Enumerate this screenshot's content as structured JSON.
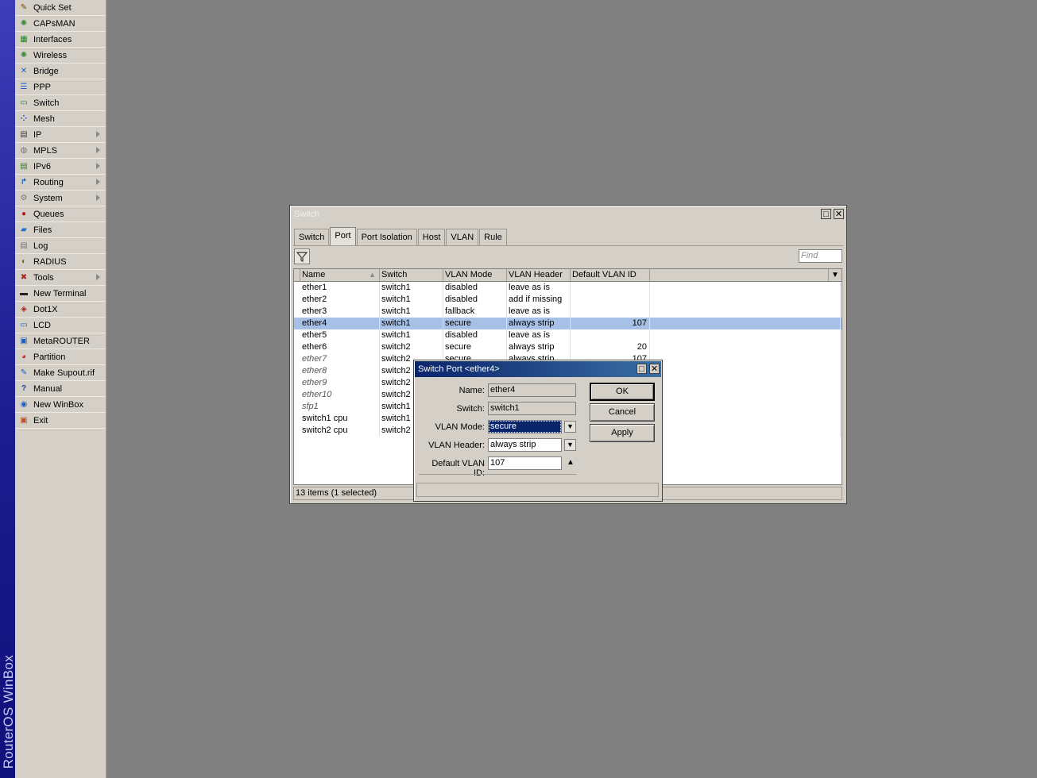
{
  "brand": "RouterOS WinBox",
  "sidebar": {
    "items": [
      {
        "label": "Quick Set",
        "icon": "wand-icon",
        "glyph": "✎",
        "color": "#7a4b00",
        "submenu": false
      },
      {
        "label": "CAPsMAN",
        "icon": "wifi-icon",
        "glyph": "✺",
        "color": "#3a8a3a",
        "submenu": false
      },
      {
        "label": "Interfaces",
        "icon": "interfaces-icon",
        "glyph": "▦",
        "color": "#228b22",
        "submenu": false
      },
      {
        "label": "Wireless",
        "icon": "wireless-icon",
        "glyph": "✺",
        "color": "#3a8a3a",
        "submenu": false
      },
      {
        "label": "Bridge",
        "icon": "bridge-icon",
        "glyph": "✕",
        "color": "#1f5fbf",
        "submenu": false
      },
      {
        "label": "PPP",
        "icon": "ppp-icon",
        "glyph": "☰",
        "color": "#1f5fbf",
        "submenu": false
      },
      {
        "label": "Switch",
        "icon": "switch-icon",
        "glyph": "▭",
        "color": "#2f7f2f",
        "submenu": false
      },
      {
        "label": "Mesh",
        "icon": "mesh-icon",
        "glyph": "⁘",
        "color": "#1f3f9f",
        "submenu": false
      },
      {
        "label": "IP",
        "icon": "ip-icon",
        "glyph": "▤",
        "color": "#444444",
        "submenu": true
      },
      {
        "label": "MPLS",
        "icon": "mpls-icon",
        "glyph": "◍",
        "color": "#777777",
        "submenu": true
      },
      {
        "label": "IPv6",
        "icon": "ipv6-icon",
        "glyph": "▤",
        "color": "#2f7f2f",
        "submenu": true
      },
      {
        "label": "Routing",
        "icon": "routing-icon",
        "glyph": "↱",
        "color": "#1f5fbf",
        "submenu": true
      },
      {
        "label": "System",
        "icon": "gear-icon",
        "glyph": "⚙",
        "color": "#777777",
        "submenu": true
      },
      {
        "label": "Queues",
        "icon": "queues-icon",
        "glyph": "●",
        "color": "#b02020",
        "submenu": false
      },
      {
        "label": "Files",
        "icon": "folder-icon",
        "glyph": "▰",
        "color": "#1f6fd0",
        "submenu": false
      },
      {
        "label": "Log",
        "icon": "log-icon",
        "glyph": "▤",
        "color": "#777777",
        "submenu": false
      },
      {
        "label": "RADIUS",
        "icon": "radius-icon",
        "glyph": "◐",
        "color": "#7a5a20",
        "submenu": false
      },
      {
        "label": "Tools",
        "icon": "tools-icon",
        "glyph": "✖",
        "color": "#b02020",
        "submenu": true
      },
      {
        "label": "New Terminal",
        "icon": "terminal-icon",
        "glyph": "▬",
        "color": "#222222",
        "submenu": false
      },
      {
        "label": "Dot1X",
        "icon": "dot1x-icon",
        "glyph": "◈",
        "color": "#b02020",
        "submenu": false
      },
      {
        "label": "LCD",
        "icon": "lcd-icon",
        "glyph": "▭",
        "color": "#1f5fbf",
        "submenu": false
      },
      {
        "label": "MetaROUTER",
        "icon": "metarouter-icon",
        "glyph": "▣",
        "color": "#1f5fbf",
        "submenu": false
      },
      {
        "label": "Partition",
        "icon": "partition-icon",
        "glyph": "◕",
        "color": "#c03030",
        "submenu": false
      },
      {
        "label": "Make Supout.rif",
        "icon": "supout-icon",
        "glyph": "✎",
        "color": "#1f5fbf",
        "submenu": false
      },
      {
        "label": "Manual",
        "icon": "manual-icon",
        "glyph": "?",
        "color": "#1f3f9f",
        "submenu": false
      },
      {
        "label": "New WinBox",
        "icon": "winbox-icon",
        "glyph": "◉",
        "color": "#1f5fbf",
        "submenu": false
      },
      {
        "label": "Exit",
        "icon": "exit-icon",
        "glyph": "▣",
        "color": "#c05020",
        "submenu": false
      }
    ]
  },
  "switch_window": {
    "title": "Switch",
    "tabs": [
      "Switch",
      "Port",
      "Port Isolation",
      "Host",
      "VLAN",
      "Rule"
    ],
    "active_tab": "Port",
    "find_placeholder": "Find",
    "columns": [
      "Name",
      "Switch",
      "VLAN Mode",
      "VLAN Header",
      "Default VLAN ID"
    ],
    "rows": [
      {
        "name": "ether1",
        "switch": "switch1",
        "vlan_mode": "disabled",
        "vlan_header": "leave as is",
        "default_vlan_id": "",
        "disabled": false,
        "selected": false
      },
      {
        "name": "ether2",
        "switch": "switch1",
        "vlan_mode": "disabled",
        "vlan_header": "add if missing",
        "default_vlan_id": "",
        "disabled": false,
        "selected": false
      },
      {
        "name": "ether3",
        "switch": "switch1",
        "vlan_mode": "fallback",
        "vlan_header": "leave as is",
        "default_vlan_id": "",
        "disabled": false,
        "selected": false
      },
      {
        "name": "ether4",
        "switch": "switch1",
        "vlan_mode": "secure",
        "vlan_header": "always strip",
        "default_vlan_id": "107",
        "disabled": false,
        "selected": true
      },
      {
        "name": "ether5",
        "switch": "switch1",
        "vlan_mode": "disabled",
        "vlan_header": "leave as is",
        "default_vlan_id": "",
        "disabled": false,
        "selected": false
      },
      {
        "name": "ether6",
        "switch": "switch2",
        "vlan_mode": "secure",
        "vlan_header": "always strip",
        "default_vlan_id": "20",
        "disabled": false,
        "selected": false
      },
      {
        "name": "ether7",
        "switch": "switch2",
        "vlan_mode": "secure",
        "vlan_header": "always strip",
        "default_vlan_id": "107",
        "disabled": true,
        "selected": false
      },
      {
        "name": "ether8",
        "switch": "switch2",
        "vlan_mode": "",
        "vlan_header": "",
        "default_vlan_id": "",
        "disabled": true,
        "selected": false
      },
      {
        "name": "ether9",
        "switch": "switch2",
        "vlan_mode": "",
        "vlan_header": "",
        "default_vlan_id": "",
        "disabled": true,
        "selected": false
      },
      {
        "name": "ether10",
        "switch": "switch2",
        "vlan_mode": "",
        "vlan_header": "",
        "default_vlan_id": "",
        "disabled": true,
        "selected": false
      },
      {
        "name": "sfp1",
        "switch": "switch1",
        "vlan_mode": "",
        "vlan_header": "",
        "default_vlan_id": "",
        "disabled": true,
        "selected": false
      },
      {
        "name": "switch1 cpu",
        "switch": "switch1",
        "vlan_mode": "",
        "vlan_header": "",
        "default_vlan_id": "",
        "disabled": false,
        "selected": false
      },
      {
        "name": "switch2 cpu",
        "switch": "switch2",
        "vlan_mode": "",
        "vlan_header": "",
        "default_vlan_id": "",
        "disabled": false,
        "selected": false
      }
    ],
    "status": "13 items (1 selected)"
  },
  "dialog": {
    "title": "Switch Port <ether4>",
    "fields": {
      "name": {
        "label": "Name:",
        "value": "ether4"
      },
      "switch": {
        "label": "Switch:",
        "value": "switch1"
      },
      "vlan_mode": {
        "label": "VLAN Mode:",
        "value": "secure"
      },
      "vlan_header": {
        "label": "VLAN Header:",
        "value": "always strip"
      },
      "default_vlan_id": {
        "label": "Default VLAN ID:",
        "value": "107"
      }
    },
    "buttons": {
      "ok": "OK",
      "cancel": "Cancel",
      "apply": "Apply"
    }
  },
  "colors": {
    "selection": "#a7c1e6",
    "dialog_title": "#0a246a",
    "desktop": "#808080"
  }
}
